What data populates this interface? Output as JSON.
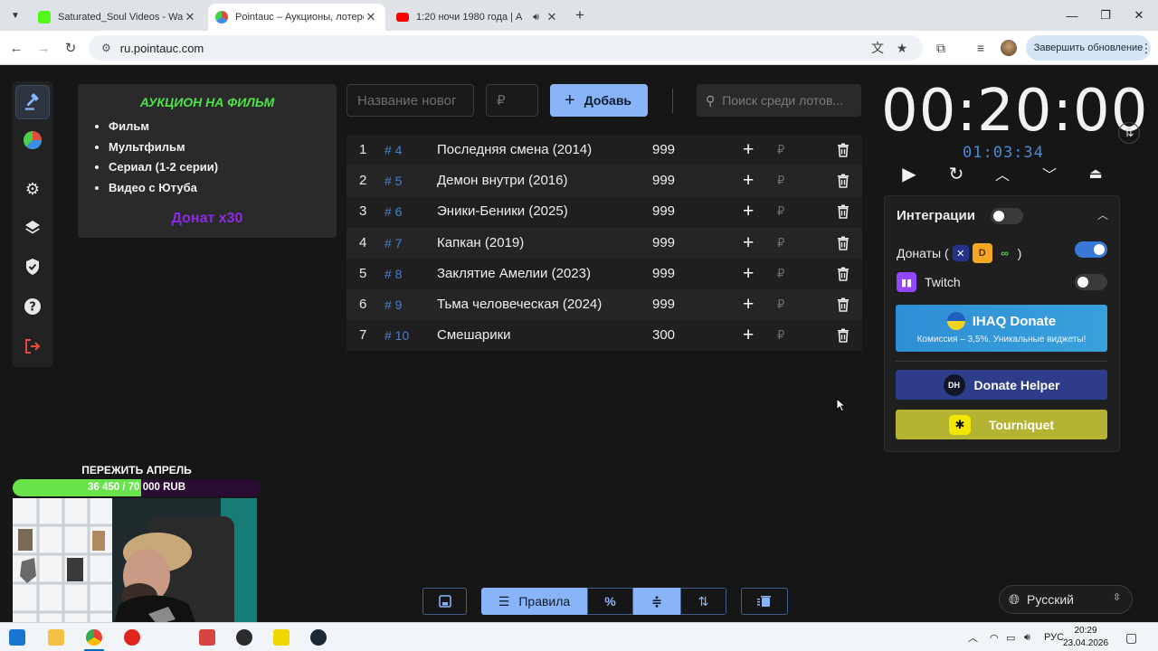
{
  "browser": {
    "tabs": [
      {
        "title": "Saturated_Soul Videos - Watch",
        "color": "#53fc18"
      },
      {
        "title": "Pointauc – Аукционы, лотереи",
        "color": "#e64a3c"
      },
      {
        "title": "1:20 ночи 1980 года | A",
        "color": "#ff0000"
      }
    ],
    "url": "ru.pointauc.com",
    "update_label": "Завершить обновление"
  },
  "rules": {
    "title": "АУКЦИОН НА ФИЛЬМ",
    "items": [
      "Фильм",
      "Мультфильм",
      "Сериал (1-2 серии)",
      "Видео с Ютуба"
    ],
    "footer": "Донат х30"
  },
  "toolbar": {
    "name_placeholder": "Название новог",
    "amount_placeholder": "₽",
    "add_label": "Добавь",
    "search_placeholder": "Поиск среди лотов..."
  },
  "lots": [
    {
      "n": "1",
      "id": "# 4",
      "name": "Последняя смена (2014)",
      "amount": "999"
    },
    {
      "n": "2",
      "id": "# 5",
      "name": "Демон внутри (2016)",
      "amount": "999"
    },
    {
      "n": "3",
      "id": "# 6",
      "name": "Эники-Беники (2025)",
      "amount": "999"
    },
    {
      "n": "4",
      "id": "# 7",
      "name": "Капкан (2019)",
      "amount": "999"
    },
    {
      "n": "5",
      "id": "# 8",
      "name": "Заклятие Амелии (2023)",
      "amount": "999"
    },
    {
      "n": "6",
      "id": "# 9",
      "name": "Тьма человеческая (2024)",
      "amount": "999"
    },
    {
      "n": "7",
      "id": "# 10",
      "name": "Смешарики",
      "amount": "300"
    }
  ],
  "lot_currency": "₽",
  "timer": {
    "main": "00:20:00",
    "sub": "01:03:34"
  },
  "integrations": {
    "title": "Интеграции",
    "donations_prefix": "Донаты (",
    "donations_suffix": ")",
    "twitch": "Twitch",
    "ihaq_title": "IHAQ Donate",
    "ihaq_sub": "Комиссия – 3,5%. Уникальные виджеты!",
    "donate_helper": "Donate Helper",
    "tourniquet": "Tourniquet",
    "dh_logo": "DH"
  },
  "bottom": {
    "rules_label": "Правила",
    "percent": "%"
  },
  "language": "Русский",
  "overlay": {
    "goal_title": "ПЕРЕЖИТЬ АПРЕЛЬ",
    "goal_text": "36 450 / 70 000 RUB",
    "goal_progress": 0.52
  },
  "taskbar": {
    "lang": "РУС",
    "time": "20:29",
    "date": "23.04.2026"
  }
}
